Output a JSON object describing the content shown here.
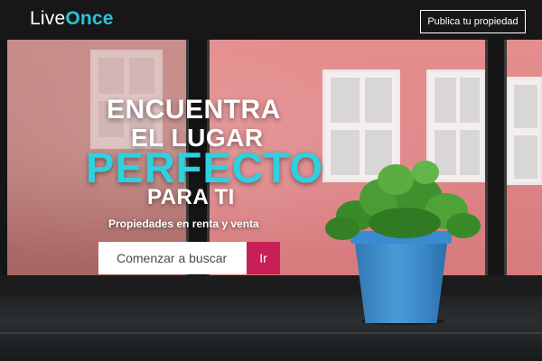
{
  "header": {
    "logo_part1": "Live",
    "logo_part2": "Once",
    "publish_label": "Publica tu propiedad"
  },
  "hero": {
    "line1": "ENCUENTRA",
    "line2": "EL LUGAR",
    "line3": "PERFECTO",
    "line4": "PARA TI",
    "tagline": "Propiedades en renta y venta"
  },
  "search": {
    "placeholder": "Comenzar a buscar",
    "button_label": "Ir"
  },
  "colors": {
    "accent": "#2fd0e0",
    "button": "#c91f58",
    "topbar": "#171717"
  }
}
